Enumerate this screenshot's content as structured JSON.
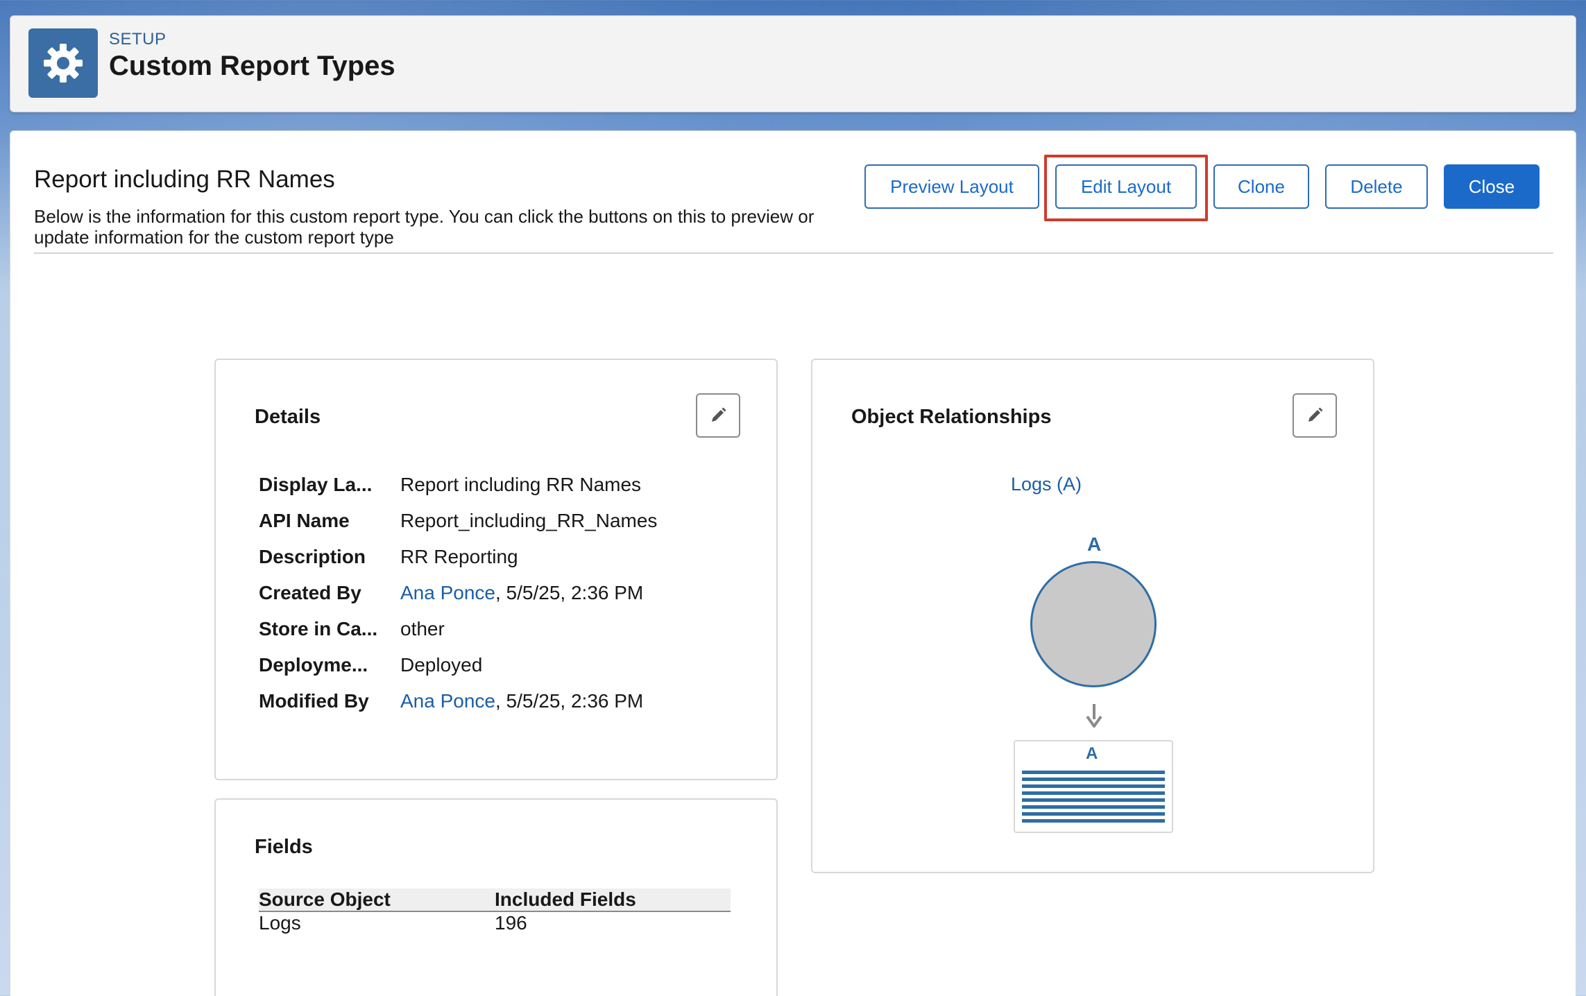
{
  "header": {
    "breadcrumb": "SETUP",
    "title": "Custom Report Types",
    "icon": "gear-icon"
  },
  "page": {
    "heading": "Report including RR Names",
    "description": "Below is the information for this custom report type. You can click the buttons on this to preview or update information for the custom report type"
  },
  "toolbar": {
    "preview_layout": "Preview Layout",
    "edit_layout": "Edit Layout",
    "clone": "Clone",
    "delete": "Delete",
    "close": "Close"
  },
  "details": {
    "title": "Details",
    "rows": [
      {
        "label": "Display La...",
        "value": "Report including RR Names"
      },
      {
        "label": "API Name",
        "value": "Report_including_RR_Names"
      },
      {
        "label": "Description",
        "value": "RR Reporting"
      },
      {
        "label": "Created By",
        "link": "Ana Ponce",
        "value": ", 5/5/25, 2:36 PM"
      },
      {
        "label": "Store in Ca...",
        "value": "other"
      },
      {
        "label": "Deployme...",
        "value": "Deployed"
      },
      {
        "label": "Modified By",
        "link": "Ana Ponce",
        "value": ", 5/5/25, 2:36 PM"
      }
    ]
  },
  "fields": {
    "title": "Fields",
    "headers": [
      "Source Object",
      "Included Fields"
    ],
    "rows": [
      [
        "Logs",
        "196"
      ]
    ]
  },
  "relationships": {
    "title": "Object Relationships",
    "object_link": "Logs (A)",
    "circle_label": "A",
    "table_label": "A"
  },
  "colors": {
    "brand": "#1b6ac9",
    "highlight": "#d03a2b",
    "link": "#1b5ea6"
  }
}
